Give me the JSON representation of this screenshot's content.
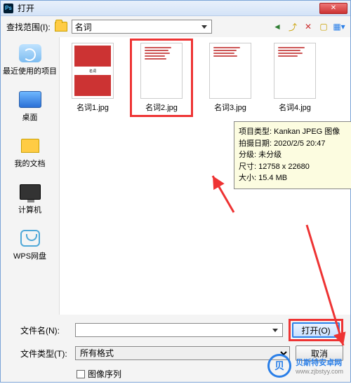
{
  "window": {
    "title": "打开"
  },
  "toolbar": {
    "look_in_label": "查找范围(I):",
    "current_folder": "名词"
  },
  "places": {
    "recent": "最近使用的项目",
    "desktop": "桌面",
    "documents": "我的文档",
    "computer": "计算机",
    "wps": "WPS网盘"
  },
  "files": [
    {
      "name": "名词1.jpg"
    },
    {
      "name": "名词2.jpg"
    },
    {
      "name": "名词3.jpg"
    },
    {
      "name": "名词4.jpg"
    }
  ],
  "tooltip": {
    "type_label": "项目类型:",
    "type_value": "Kankan JPEG 图像",
    "date_label": "拍摄日期:",
    "date_value": "2020/2/5 20:47",
    "rating_label": "分级:",
    "rating_value": "未分级",
    "size_label": "尺寸:",
    "size_value": "12758 x 22680",
    "filesize_label": "大小:",
    "filesize_value": "15.4 MB"
  },
  "bottom": {
    "filename_label": "文件名(N):",
    "filename_value": "",
    "filetype_label": "文件类型(T):",
    "filetype_value": "所有格式",
    "open_btn": "打开(O)",
    "cancel_btn": "取消",
    "sequence_label": "图像序列"
  },
  "file_card": {
    "mid_text": "名词"
  },
  "watermark": {
    "name": "贝斯特安卓网",
    "url": "www.zjbstyy.com",
    "icon_text": "贝"
  }
}
